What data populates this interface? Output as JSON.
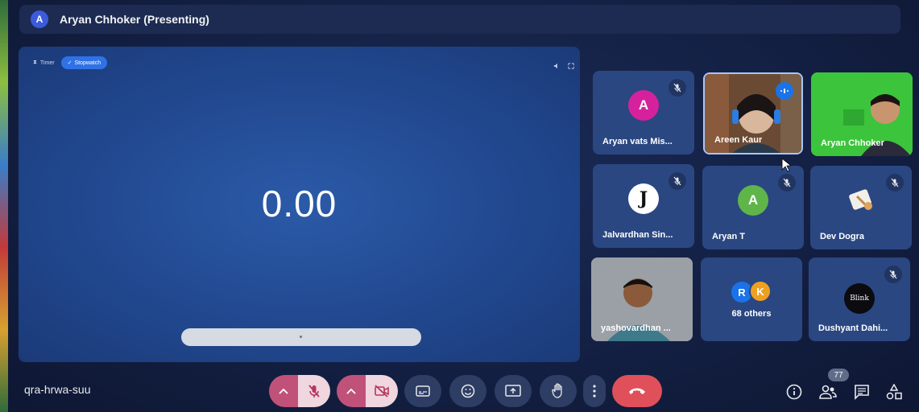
{
  "presenting": {
    "avatar_letter": "A",
    "title": "Aryan Chhoker (Presenting)"
  },
  "stage": {
    "tab_timer": "Timer",
    "tab_stopwatch": "Stopwatch",
    "stopwatch_value": "0.00"
  },
  "tiles": [
    {
      "name": "Aryan vats Mis...",
      "letter": "A",
      "avatar_color": "#d6219c",
      "muted": true
    },
    {
      "name": "Areen Kaur",
      "muted": false,
      "speaking": true
    },
    {
      "name": "Aryan Chhoker",
      "muted": false
    },
    {
      "name": "Jalvardhan Sin...",
      "letter": "J",
      "muted": true
    },
    {
      "name": "Aryan T",
      "letter": "A",
      "avatar_color": "#5fb54a",
      "muted": true
    },
    {
      "name": "Dev Dogra",
      "muted": true
    },
    {
      "name": "yashovardhan ...",
      "muted": false
    },
    {
      "name": "68 others",
      "letters": [
        "R",
        "K"
      ],
      "muted": false
    },
    {
      "name": "Dushyant Dahi...",
      "avatar_text": "Blink",
      "muted": true
    }
  ],
  "bottom": {
    "meeting_code": "qra-hrwa-suu",
    "participants_count": "77"
  },
  "colors": {
    "accent": "#2f72e6",
    "end_call": "#e0505a",
    "mic_off_bg": "#c0527a"
  },
  "icons": {
    "mute": "mic-off-icon",
    "camera": "videocam-off-icon",
    "captions": "captions-icon",
    "emoji": "emoji-icon",
    "present": "present-screen-icon",
    "hand": "raise-hand-icon",
    "more": "more-vert-icon",
    "end": "call-end-icon",
    "info": "info-icon",
    "people": "people-icon",
    "chat": "chat-icon",
    "activities": "activities-icon"
  }
}
